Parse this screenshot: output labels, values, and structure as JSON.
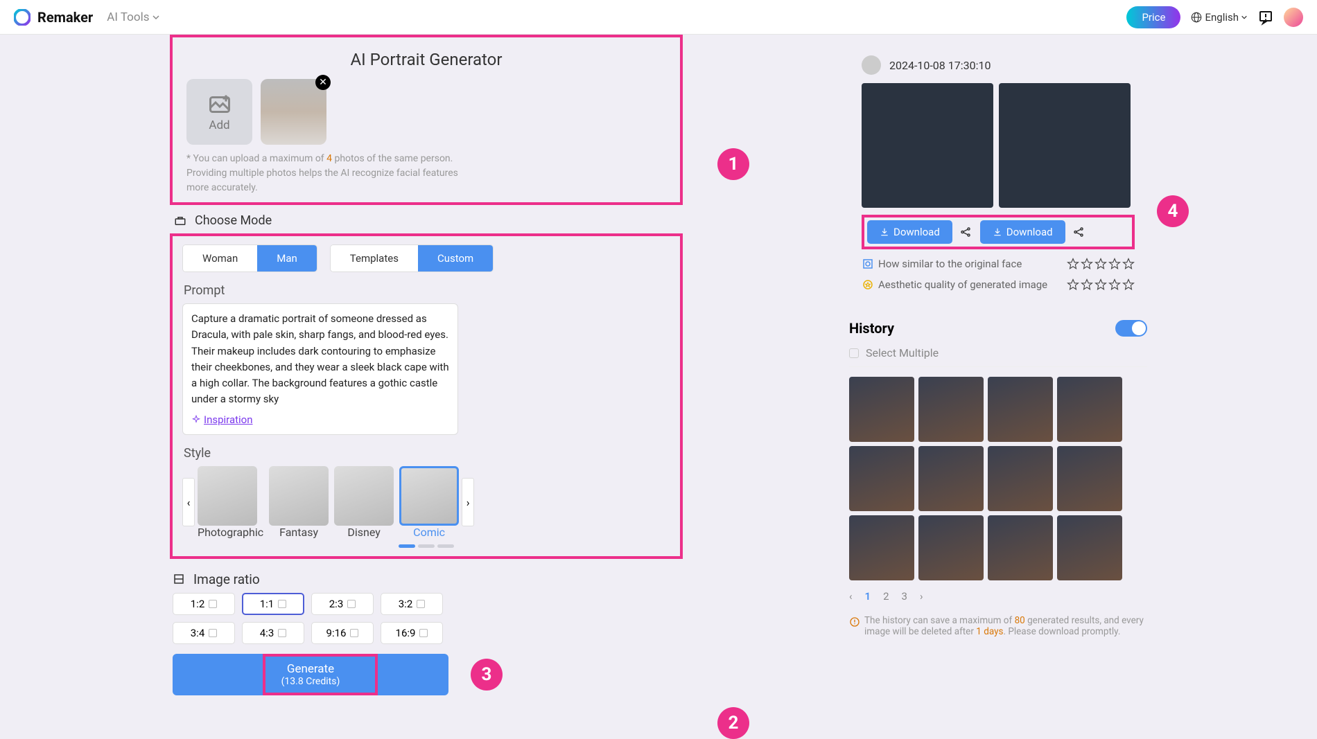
{
  "header": {
    "brand": "Remaker",
    "ai_tools": "AI Tools",
    "price": "Price",
    "language": "English"
  },
  "left": {
    "title": "AI Portrait Generator",
    "add_label": "Add",
    "upload_note_pre": "* You can upload a maximum of ",
    "upload_note_num": "4",
    "upload_note_post": " photos of the same person. Providing multiple photos helps the AI recognize facial features more accurately.",
    "choose_mode": "Choose Mode",
    "modes": {
      "woman": "Woman",
      "man": "Man",
      "templates": "Templates",
      "custom": "Custom"
    },
    "prompt_label": "Prompt",
    "prompt_value": "Capture a dramatic portrait of someone dressed as Dracula, with pale skin, sharp fangs, and blood-red eyes. Their makeup includes dark contouring to emphasize their cheekbones, and they wear a sleek black cape with a high collar. The background features a gothic castle under a stormy sky",
    "inspiration": "Inspiration",
    "style_label": "Style",
    "styles": [
      "Photographic",
      "Fantasy",
      "Disney",
      "Comic"
    ],
    "ratio_label": "Image ratio",
    "ratios": [
      "1:2",
      "1:1",
      "2:3",
      "3:2",
      "3:4",
      "4:3",
      "9:16",
      "16:9"
    ],
    "generate_label": "Generate",
    "generate_sub": "(13.8 Credits)"
  },
  "badges": {
    "b1": "1",
    "b2": "2",
    "b3": "3",
    "b4": "4"
  },
  "right": {
    "timestamp": "2024-10-08 17:30:10",
    "download": "Download",
    "similar_label": "How similar to the original face",
    "aesthetic_label": "Aesthetic quality of generated image",
    "history_title": "History",
    "select_multiple": "Select Multiple",
    "pages": [
      "1",
      "2",
      "3"
    ],
    "history_note_pre": "The history can save a maximum of ",
    "history_note_num": "80",
    "history_note_mid": " generated results, and every image will be deleted after ",
    "history_note_days": "1 days",
    "history_note_post": ". Please download promptly."
  }
}
